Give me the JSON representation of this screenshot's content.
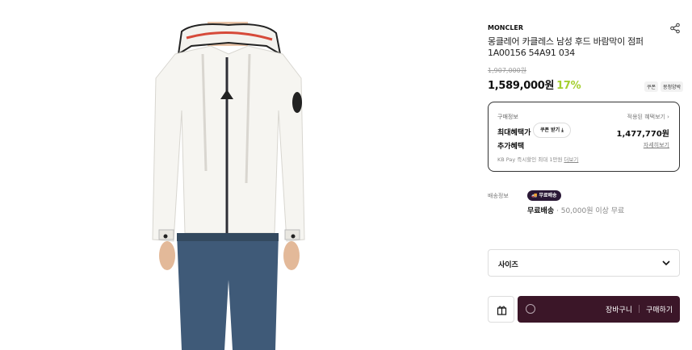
{
  "product": {
    "brand": "MONCLER",
    "title": "몽클레어 카클레스 남성 후드 바람막이 점퍼 1A00156 54A91 034",
    "original_price": "1,907,000원",
    "price": "1,589,000원",
    "discount": "17%",
    "tags": [
      "쿠폰",
      "몽청양박"
    ],
    "image_icon": "product-photo-white-hooded-jacket"
  },
  "benefit": {
    "title": "구매정보",
    "link": "적용된 혜택보기 ›",
    "max_label": "최대혜택가",
    "coupon_button": "쿠폰 받기 ⤓",
    "max_amount": "1,477,770원",
    "extra_label": "추가혜택",
    "detail_link": "자세히보기",
    "kb_text": "KB Pay 즉시할인 최대 1만원",
    "kb_link": "더보기"
  },
  "shipping": {
    "label": "배송정보",
    "badge": "무료배송",
    "badge_icon": "truck-icon",
    "free_text": "무료배송",
    "condition": "· 50,000원 이상 무료"
  },
  "options": {
    "size_label": "사이즈"
  },
  "actions": {
    "cart": "장바구니",
    "buy": "구매하기",
    "gift_icon": "gift-icon",
    "loading_icon": "spinner-icon"
  },
  "colors": {
    "discount": "#a4cf2e",
    "buy_bar": "#3b1628",
    "badge": "#2a1836"
  }
}
